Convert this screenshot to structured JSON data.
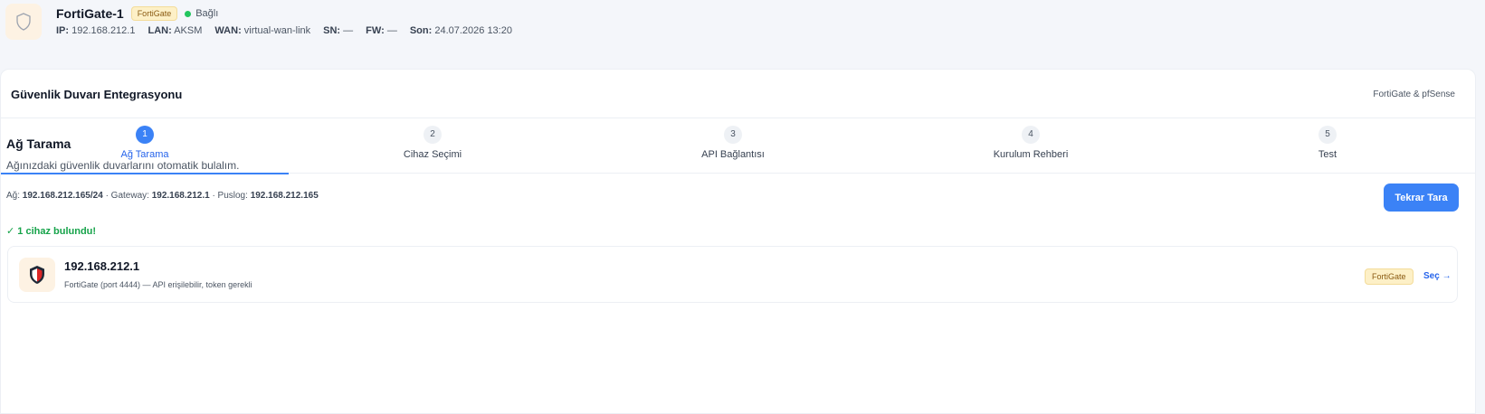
{
  "device": {
    "name": "FortiGate-1",
    "badge": "FortiGate",
    "status": "Bağlı",
    "meta": [
      {
        "key": "IP:",
        "value": "192.168.212.1"
      },
      {
        "key": "LAN:",
        "value": "AKSM"
      },
      {
        "key": "WAN:",
        "value": "virtual-wan-link"
      },
      {
        "key": "SN:",
        "value": "—"
      },
      {
        "key": "FW:",
        "value": "—"
      },
      {
        "key": "Son:",
        "value": "24.07.2026 13:20"
      }
    ]
  },
  "card": {
    "title": "Güvenlik Duvarı Entegrasyonu",
    "tag": "FortiGate & pfSense"
  },
  "steps": [
    {
      "num": "1",
      "label": "Ağ Tarama"
    },
    {
      "num": "2",
      "label": "Cihaz Seçimi"
    },
    {
      "num": "3",
      "label": "API Bağlantısı"
    },
    {
      "num": "4",
      "label": "Kurulum Rehberi"
    },
    {
      "num": "5",
      "label": "Test"
    }
  ],
  "scan": {
    "title": "Ağ Tarama",
    "subtitle": "Ağınızdaki güvenlik duvarlarını otomatik bulalım.",
    "net_label": "Ağ:",
    "net_value": "192.168.212.165/24",
    "gateway_label": "· Gateway:",
    "gateway_value": "192.168.212.1",
    "puslog_label": "· Puslog:",
    "puslog_value": "192.168.212.165",
    "rescan_label": "Tekrar Tara",
    "found_text": "✓ 1 cihaz bulundu!"
  },
  "results": [
    {
      "ip": "192.168.212.1",
      "desc": "FortiGate (port 4444) — API erişilebilir, token gerekli",
      "badge": "FortiGate",
      "select_label": "Seç →"
    }
  ],
  "colors": {
    "accent": "#3b82f6",
    "success": "#16a34a",
    "badge_bg": "#fdf0c7"
  }
}
